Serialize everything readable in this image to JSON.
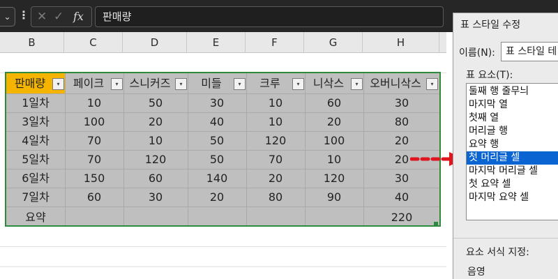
{
  "formula_bar": {
    "dropdown_glyph": "⌄",
    "dots_glyph": "⋮",
    "cancel_glyph": "✕",
    "confirm_glyph": "✓",
    "fx_label": "fx",
    "value": "판매량"
  },
  "columns": [
    "B",
    "C",
    "D",
    "E",
    "F",
    "G",
    "H"
  ],
  "table": {
    "headers": [
      "판매량",
      "페이크",
      "스니커즈",
      "미들",
      "크루",
      "니삭스",
      "오버니삭스"
    ],
    "filter_glyph": "▾",
    "rows": [
      [
        "1일차",
        "10",
        "50",
        "30",
        "10",
        "60",
        "30"
      ],
      [
        "3일차",
        "100",
        "20",
        "40",
        "10",
        "20",
        "80"
      ],
      [
        "4일차",
        "70",
        "10",
        "50",
        "120",
        "100",
        "20"
      ],
      [
        "5일차",
        "70",
        "120",
        "50",
        "70",
        "10",
        "20"
      ],
      [
        "6일차",
        "150",
        "60",
        "140",
        "20",
        "120",
        "30"
      ],
      [
        "7일차",
        "60",
        "30",
        "20",
        "80",
        "90",
        "40"
      ],
      [
        "요약",
        "",
        "",
        "",
        "",
        "",
        "220"
      ]
    ]
  },
  "colors": {
    "table_border": "#2e8b3e",
    "first_header_fill": "#f4b400",
    "arrow": "#e0161e",
    "selection": "#0a64d2"
  },
  "dialog": {
    "title": "표 스타일 수정",
    "name_label": "이름(N):",
    "name_value": "표 스타일 테",
    "elements_label": "표 요소(T):",
    "elements": [
      "둘째 행 줄무늬",
      "마지막 열",
      "첫째 열",
      "머리글 행",
      "요약 행",
      "첫 머리글 셀",
      "마지막 머리글 셀",
      "첫 요약 셀",
      "마지막 요약 셀"
    ],
    "selected_element": "첫 머리글 셀",
    "format_label": "요소 서식 지정:",
    "shading_label": "음영"
  }
}
